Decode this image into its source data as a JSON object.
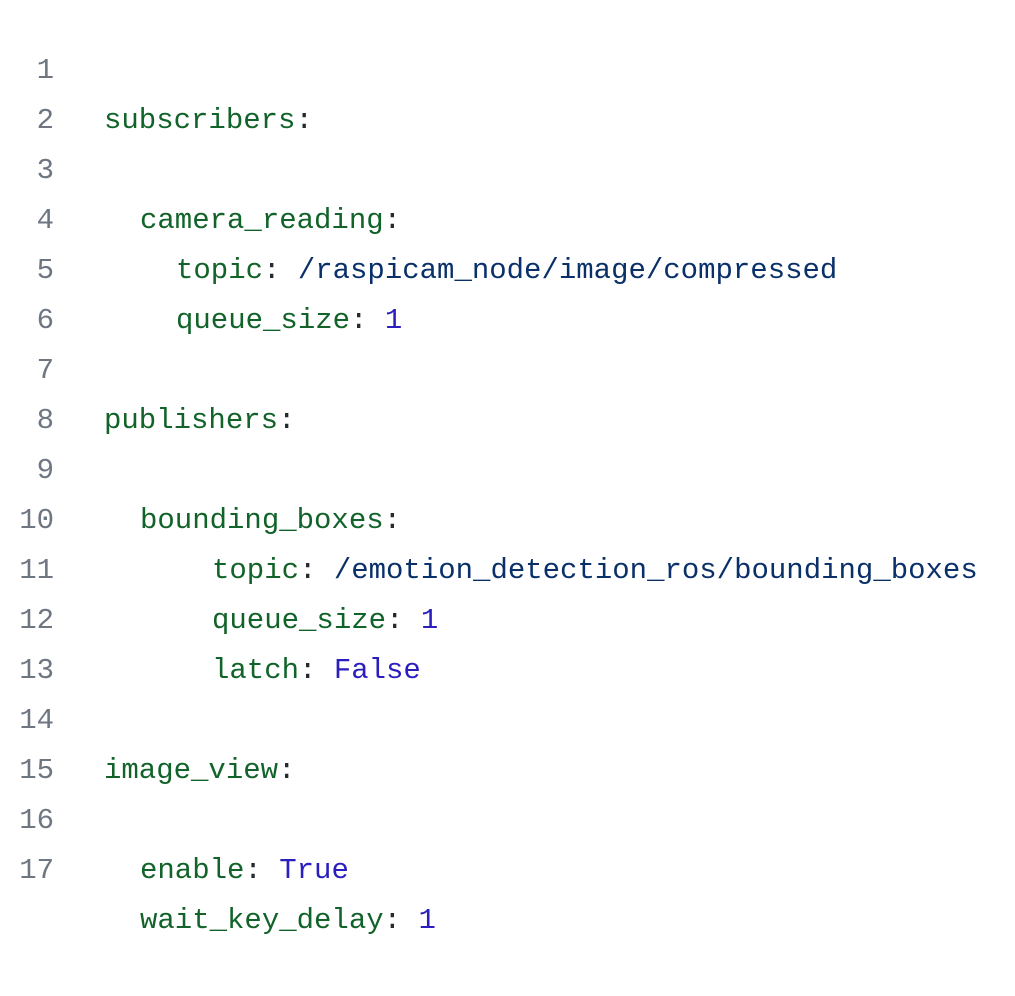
{
  "editor": {
    "colors": {
      "key": "#116329",
      "string": "#0a3069",
      "number": "#2a1ebf",
      "line_number": "#6e7681"
    },
    "lines": [
      {
        "number": "1",
        "key": "subscribers",
        "colon": ":",
        "value": ""
      },
      {
        "number": "2",
        "key": "",
        "colon": "",
        "value": ""
      },
      {
        "number": "3",
        "key": "camera_reading",
        "colon": ":",
        "value": ""
      },
      {
        "number": "4",
        "key": "topic",
        "colon": ":",
        "value": " /raspicam_node/image/compressed"
      },
      {
        "number": "5",
        "key": "queue_size",
        "colon": ":",
        "value": " 1"
      },
      {
        "number": "6",
        "key": "",
        "colon": "",
        "value": ""
      },
      {
        "number": "7",
        "key": "publishers",
        "colon": ":",
        "value": ""
      },
      {
        "number": "8",
        "key": "",
        "colon": "",
        "value": ""
      },
      {
        "number": "9",
        "key": "bounding_boxes",
        "colon": ":",
        "value": ""
      },
      {
        "number": "10",
        "key": "topic",
        "colon": ":",
        "value": " /emotion_detection_ros/bounding_boxes"
      },
      {
        "number": "11",
        "key": "queue_size",
        "colon": ":",
        "value": " 1"
      },
      {
        "number": "12",
        "key": "latch",
        "colon": ":",
        "value": " False"
      },
      {
        "number": "13",
        "key": "",
        "colon": "",
        "value": ""
      },
      {
        "number": "14",
        "key": "image_view",
        "colon": ":",
        "value": ""
      },
      {
        "number": "15",
        "key": "",
        "colon": "",
        "value": ""
      },
      {
        "number": "16",
        "key": "enable",
        "colon": ":",
        "value": " True"
      },
      {
        "number": "17",
        "key": "wait_key_delay",
        "colon": ":",
        "value": " 1"
      }
    ]
  }
}
